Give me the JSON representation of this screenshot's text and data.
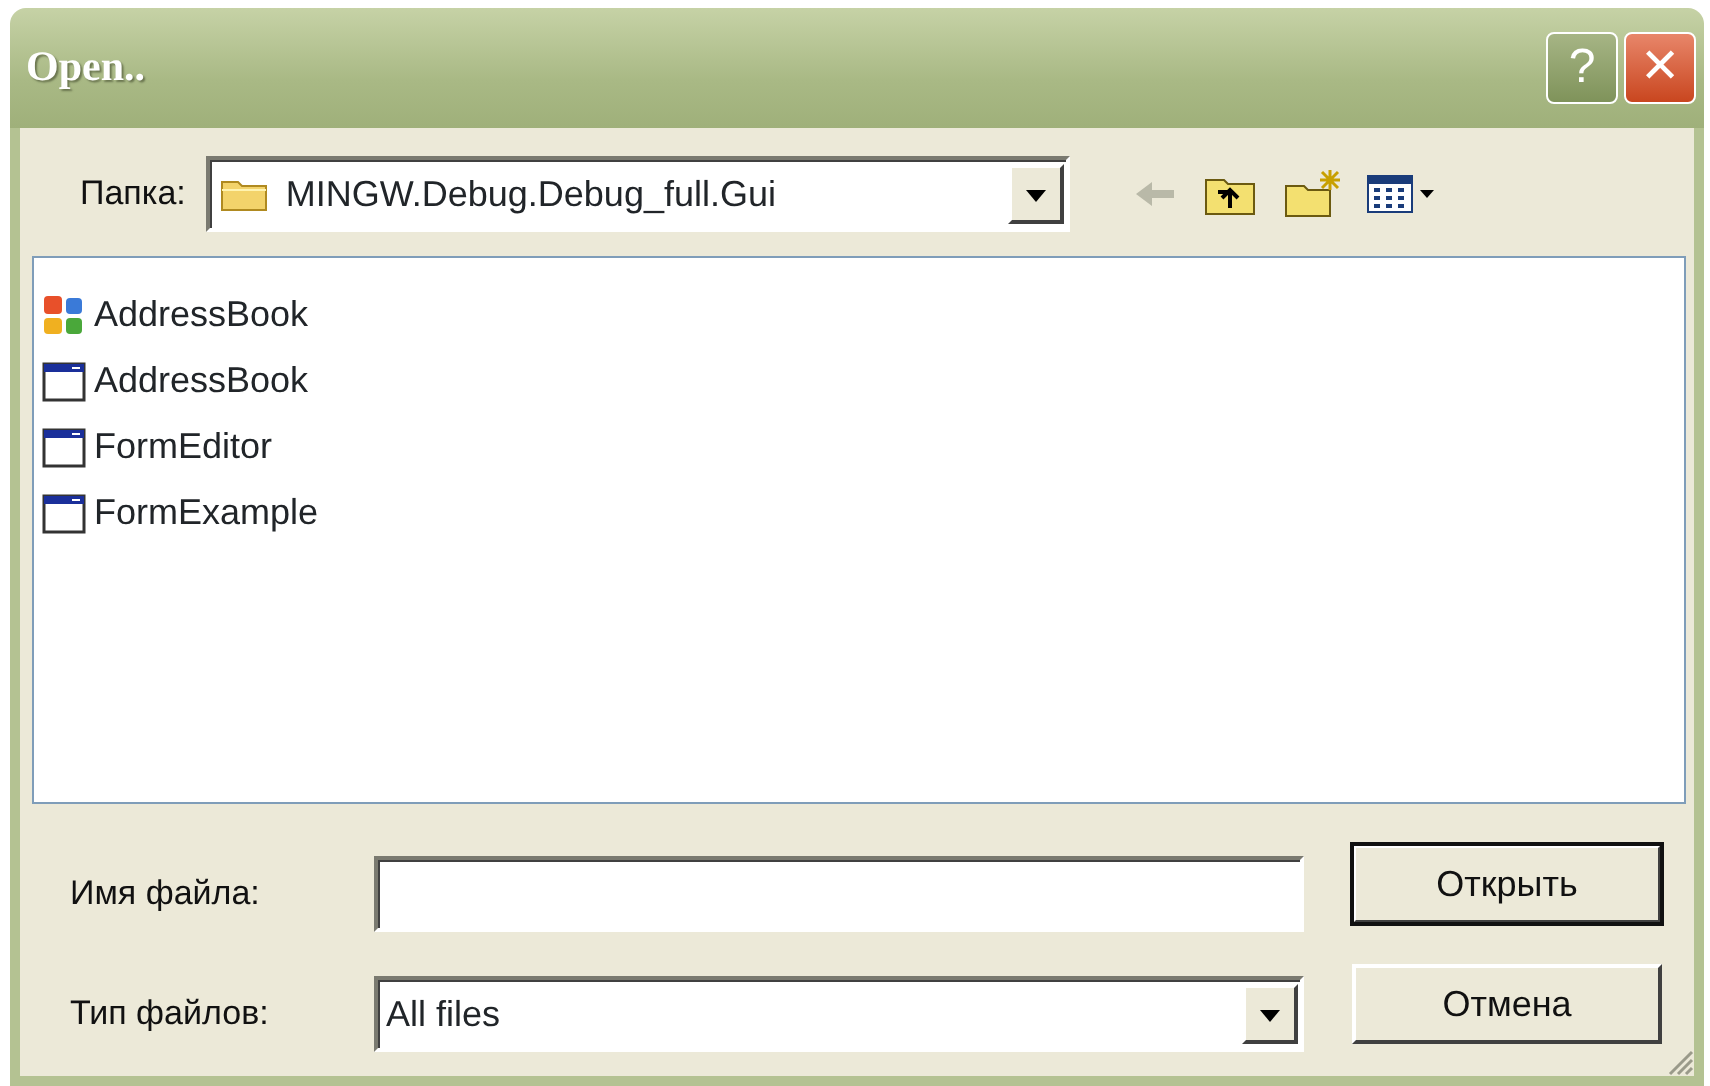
{
  "window": {
    "title": "Open.."
  },
  "title_buttons": [
    {
      "kind": "help",
      "label": "?"
    },
    {
      "kind": "close",
      "label": "✕"
    }
  ],
  "folder": {
    "label": "Папка:",
    "value": "MINGW.Debug.Debug_full.Gui"
  },
  "toolbar": [
    {
      "kind": "back"
    },
    {
      "kind": "up"
    },
    {
      "kind": "new-folder"
    },
    {
      "kind": "view"
    }
  ],
  "files": [
    {
      "name": "AddressBook",
      "kind": "project"
    },
    {
      "name": "AddressBook",
      "kind": "executable"
    },
    {
      "name": "FormEditor",
      "kind": "executable"
    },
    {
      "name": "FormExample",
      "kind": "executable"
    }
  ],
  "file_name": {
    "label": "Имя файла:"
  },
  "file_type": {
    "label": "Тип файлов:",
    "value": "All files"
  },
  "buttons": [
    {
      "label": "Открыть",
      "default": true
    },
    {
      "label": "Отмена",
      "default": false
    }
  ]
}
